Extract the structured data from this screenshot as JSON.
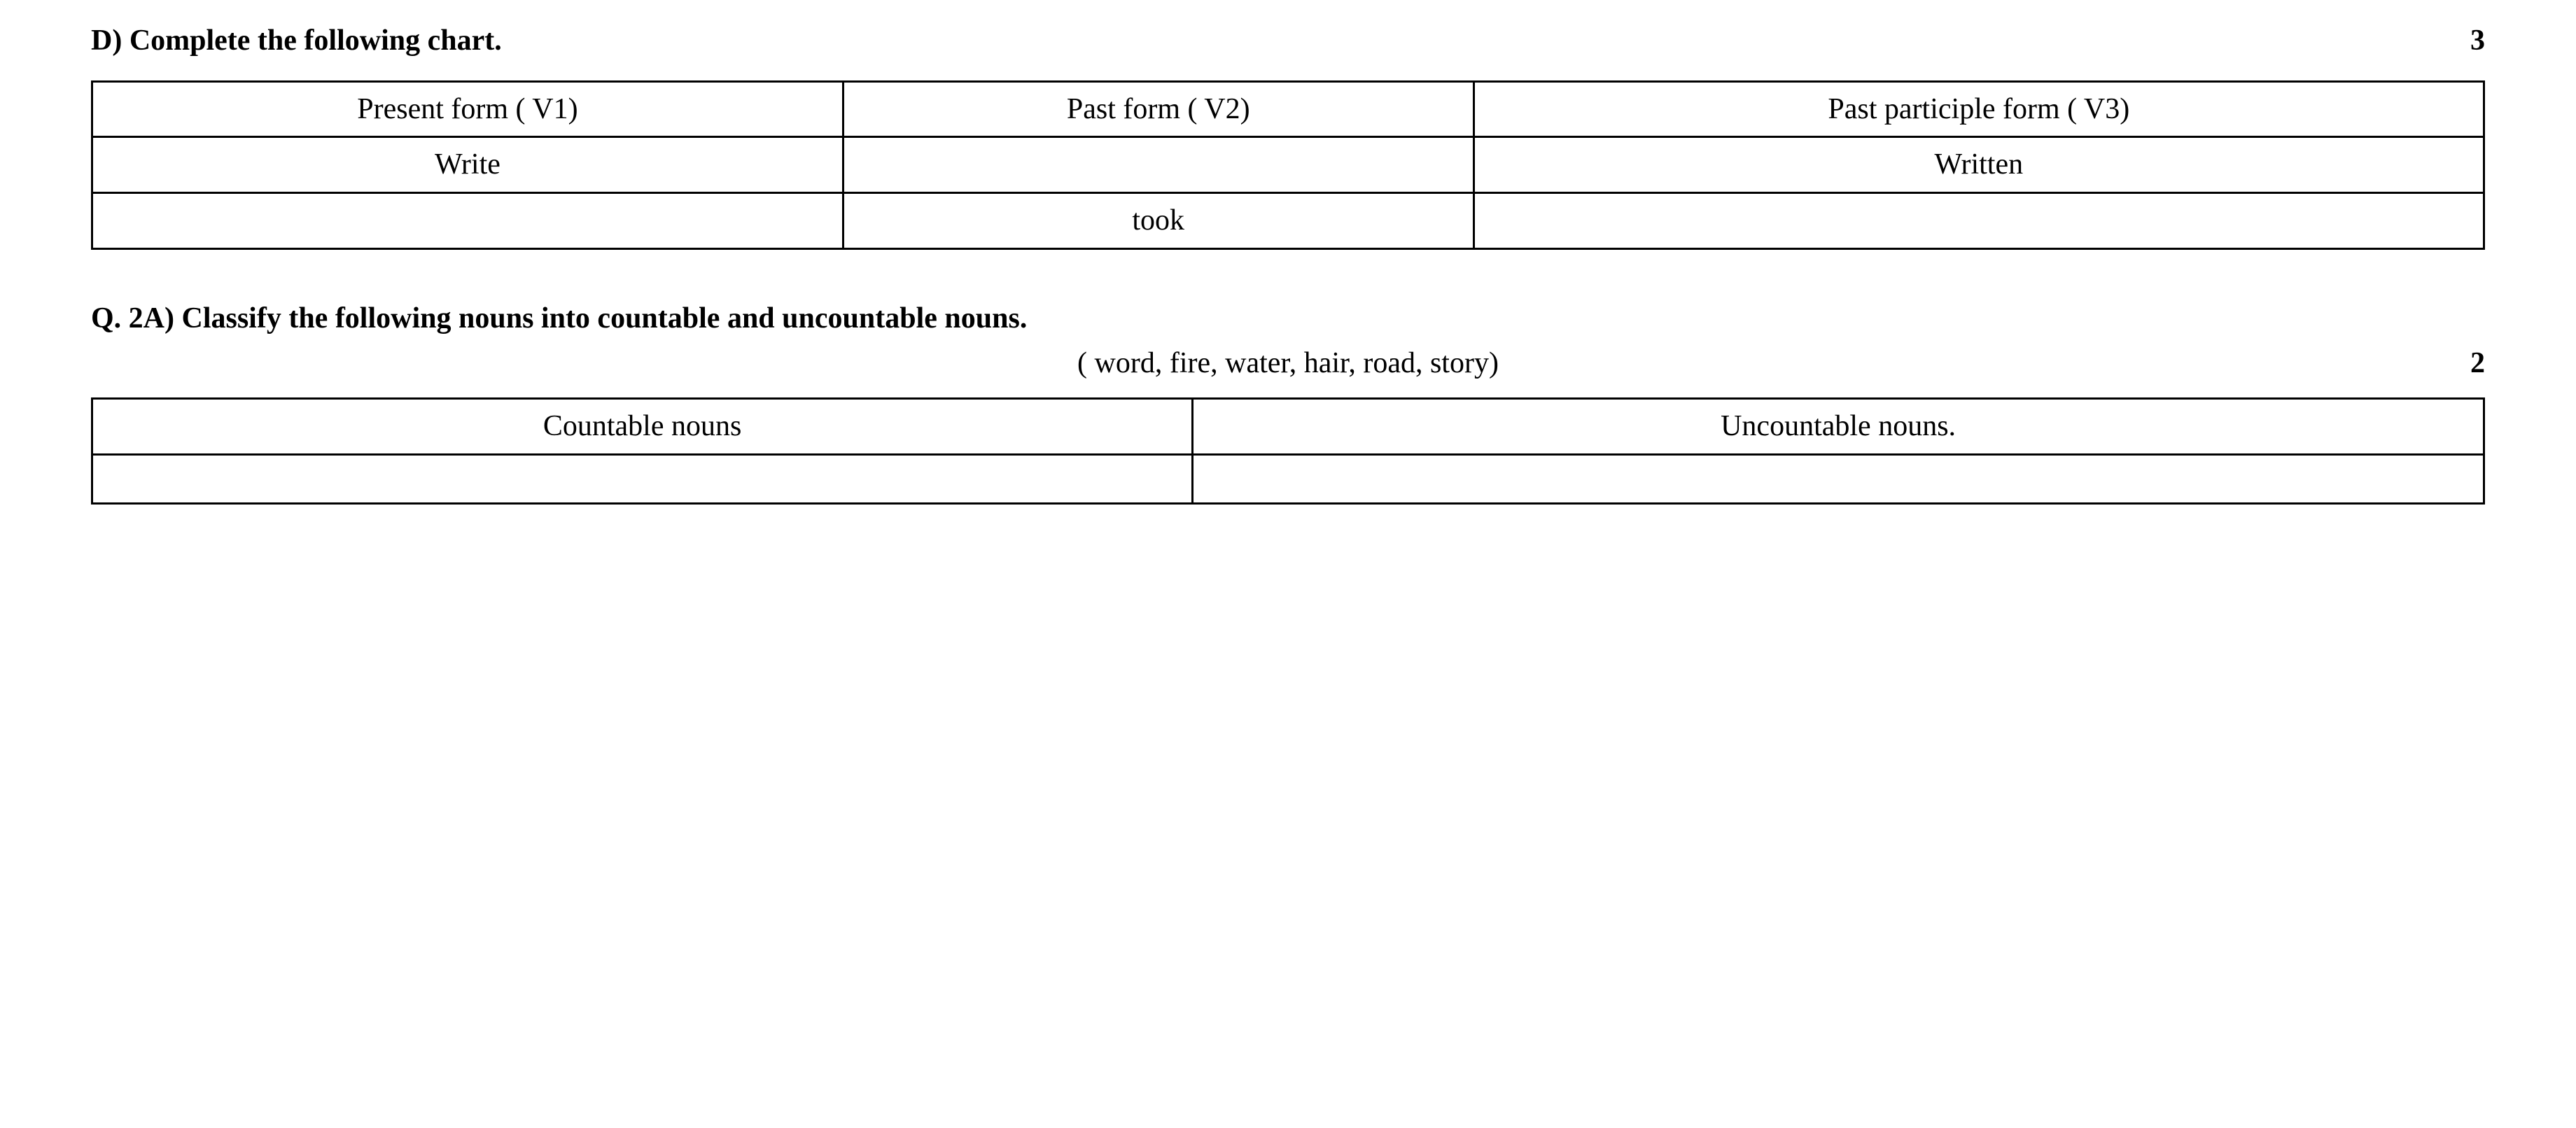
{
  "section_d": {
    "heading": "D) Complete the following chart.",
    "marks": "3",
    "table": {
      "headers": [
        "Present form ( V1)",
        "Past form ( V2)",
        "Past participle form ( V3)"
      ],
      "rows": [
        [
          "Write",
          "",
          "Written"
        ],
        [
          "",
          "took",
          ""
        ]
      ]
    }
  },
  "question_2a": {
    "heading": "Q. 2A) Classify the following nouns into countable and uncountable nouns.",
    "sub_text": "( word, fire, water, hair, road, story)",
    "marks": "2",
    "table": {
      "headers": [
        "Countable nouns",
        "Uncountable nouns."
      ],
      "rows": [
        [
          "",
          ""
        ]
      ]
    }
  }
}
